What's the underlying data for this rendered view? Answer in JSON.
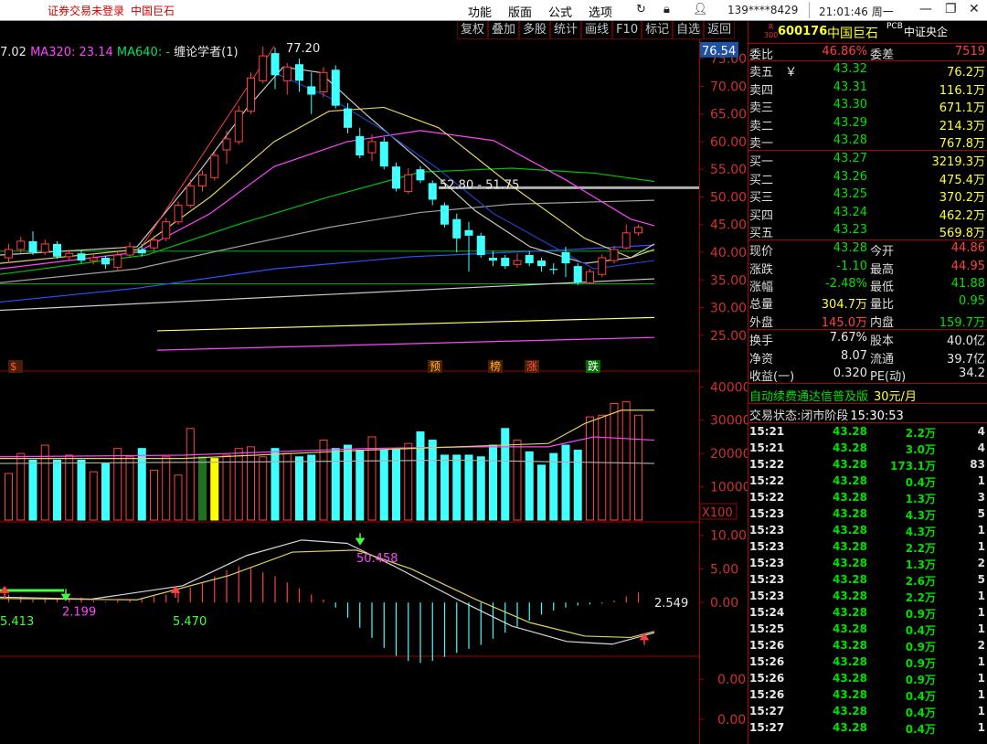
{
  "topbar": {
    "login_status": "证券交易未登录",
    "stock_name": "中国巨石",
    "menus": [
      "功能",
      "版面",
      "公式",
      "选项"
    ],
    "account": "139****8429",
    "clock": "21:01:46 周一"
  },
  "chart_toolbar": [
    "复权",
    "叠加",
    "多股",
    "统计",
    "画线",
    "F10",
    "标记",
    "自选",
    "返回"
  ],
  "legend": {
    "ma_prefix": "7.02",
    "ma320": "MA320: 23.14",
    "ma640": "MA640: -",
    "indicator": "缠论学者(1)"
  },
  "chart_data": [
    {
      "type": "candlestick",
      "price_axis": [
        "75.00",
        "70.00",
        "65.00",
        "60.00",
        "55.00",
        "50.00",
        "45.00",
        "40.00",
        "35.00",
        "30.00",
        "25.00"
      ],
      "ylim": [
        20.5,
        78.5
      ],
      "current_price_tag": "76.54",
      "annotations": {
        "high": "77.20",
        "range": "52.80 - 51.75",
        "markers": [
          "$",
          "预",
          "榜",
          "涨",
          "跌"
        ]
      },
      "candles": [
        {
          "o": 39.0,
          "c": 40.5,
          "h": 41.5,
          "l": 38.0
        },
        {
          "o": 40.5,
          "c": 42.0,
          "h": 42.8,
          "l": 39.8
        },
        {
          "o": 42.0,
          "c": 40.0,
          "h": 43.8,
          "l": 39.5
        },
        {
          "o": 40.0,
          "c": 41.5,
          "h": 42.3,
          "l": 39.5
        },
        {
          "o": 41.5,
          "c": 39.2,
          "h": 42.0,
          "l": 38.8
        },
        {
          "o": 39.2,
          "c": 39.8,
          "h": 40.5,
          "l": 38.5
        },
        {
          "o": 39.8,
          "c": 38.5,
          "h": 40.3,
          "l": 38.0
        },
        {
          "o": 38.5,
          "c": 39.0,
          "h": 39.8,
          "l": 37.8
        },
        {
          "o": 39.0,
          "c": 37.8,
          "h": 39.4,
          "l": 37.0
        },
        {
          "o": 37.3,
          "c": 39.5,
          "h": 40.2,
          "l": 36.8
        },
        {
          "o": 39.5,
          "c": 41.0,
          "h": 41.8,
          "l": 39.0
        },
        {
          "o": 40.5,
          "c": 39.8,
          "h": 41.5,
          "l": 39.2
        },
        {
          "o": 40.8,
          "c": 42.2,
          "h": 43.0,
          "l": 40.2
        },
        {
          "o": 42.5,
          "c": 45.5,
          "h": 46.2,
          "l": 42.0
        },
        {
          "o": 45.5,
          "c": 48.5,
          "h": 49.2,
          "l": 45.0
        },
        {
          "o": 48.5,
          "c": 52.0,
          "h": 53.2,
          "l": 48.0
        },
        {
          "o": 52.0,
          "c": 54.0,
          "h": 54.8,
          "l": 51.0
        },
        {
          "o": 53.5,
          "c": 57.5,
          "h": 58.3,
          "l": 53.0
        },
        {
          "o": 58.5,
          "c": 60.5,
          "h": 62.0,
          "l": 56.0
        },
        {
          "o": 60.0,
          "c": 65.5,
          "h": 66.5,
          "l": 59.5
        },
        {
          "o": 65.5,
          "c": 71.5,
          "h": 72.5,
          "l": 65.0
        },
        {
          "o": 71.0,
          "c": 75.5,
          "h": 77.2,
          "l": 70.5
        },
        {
          "o": 76.0,
          "c": 72.0,
          "h": 77.0,
          "l": 69.5
        },
        {
          "o": 71.0,
          "c": 73.5,
          "h": 74.2,
          "l": 68.5
        },
        {
          "o": 74.0,
          "c": 71.0,
          "h": 75.0,
          "l": 69.0
        },
        {
          "o": 70.0,
          "c": 68.5,
          "h": 72.5,
          "l": 65.0
        },
        {
          "o": 69.0,
          "c": 72.5,
          "h": 73.5,
          "l": 68.0
        },
        {
          "o": 73.0,
          "c": 66.5,
          "h": 73.8,
          "l": 66.0
        },
        {
          "o": 66.0,
          "c": 62.5,
          "h": 67.0,
          "l": 61.5
        },
        {
          "o": 61.0,
          "c": 57.5,
          "h": 62.5,
          "l": 57.0
        },
        {
          "o": 58.0,
          "c": 60.0,
          "h": 61.3,
          "l": 56.5
        },
        {
          "o": 60.0,
          "c": 55.5,
          "h": 60.8,
          "l": 55.0
        },
        {
          "o": 55.5,
          "c": 51.5,
          "h": 56.2,
          "l": 51.0
        },
        {
          "o": 51.0,
          "c": 54.0,
          "h": 55.2,
          "l": 50.5
        },
        {
          "o": 55.0,
          "c": 53.0,
          "h": 55.6,
          "l": 52.5
        },
        {
          "o": 52.5,
          "c": 49.5,
          "h": 53.0,
          "l": 48.5
        },
        {
          "o": 48.5,
          "c": 45.0,
          "h": 49.0,
          "l": 44.5
        },
        {
          "o": 46.0,
          "c": 42.5,
          "h": 47.0,
          "l": 40.0
        },
        {
          "o": 44.0,
          "c": 43.0,
          "h": 45.5,
          "l": 36.5
        },
        {
          "o": 43.0,
          "c": 39.5,
          "h": 43.5,
          "l": 39.0
        },
        {
          "o": 39.0,
          "c": 38.5,
          "h": 40.2,
          "l": 37.5
        },
        {
          "o": 39.0,
          "c": 37.5,
          "h": 39.5,
          "l": 37.0
        },
        {
          "o": 37.8,
          "c": 38.5,
          "h": 39.8,
          "l": 37.2
        },
        {
          "o": 39.5,
          "c": 38.0,
          "h": 40.2,
          "l": 37.5
        },
        {
          "o": 38.5,
          "c": 37.5,
          "h": 39.0,
          "l": 36.5
        },
        {
          "o": 37.0,
          "c": 36.8,
          "h": 38.0,
          "l": 36.0
        },
        {
          "o": 40.0,
          "c": 38.0,
          "h": 41.0,
          "l": 35.5
        },
        {
          "o": 37.5,
          "c": 34.5,
          "h": 38.0,
          "l": 34.0
        },
        {
          "o": 34.5,
          "c": 36.5,
          "h": 37.0,
          "l": 34.2
        },
        {
          "o": 36.0,
          "c": 39.0,
          "h": 39.6,
          "l": 35.5
        },
        {
          "o": 38.5,
          "c": 40.5,
          "h": 41.2,
          "l": 38.0
        },
        {
          "o": 40.8,
          "c": 43.5,
          "h": 45.0,
          "l": 40.5
        },
        {
          "o": 43.5,
          "c": 44.5,
          "h": 45.0,
          "l": 43.0
        }
      ]
    },
    {
      "type": "bar",
      "title": "volume",
      "axis": [
        "40000",
        "30000",
        "20000",
        "10000"
      ],
      "unit": "X100",
      "ylim": [
        0,
        42000
      ],
      "values": [
        14000,
        20000,
        18000,
        22500,
        18000,
        19500,
        18000,
        14500,
        17000,
        21500,
        19000,
        21500,
        15000,
        19000,
        13500,
        27500,
        19000,
        18500,
        19500,
        21500,
        22000,
        19000,
        21500,
        20000,
        19000,
        19500,
        24000,
        21500,
        22500,
        21000,
        25000,
        21000,
        21500,
        23000,
        26500,
        24000,
        19500,
        19500,
        19500,
        19000,
        22500,
        27500,
        24000,
        20500,
        16500,
        20000,
        22500,
        21000,
        31000,
        31500,
        35000,
        35500,
        31500
      ]
    },
    {
      "type": "bar",
      "title": "macd",
      "axis": [
        "10.00",
        "5.00",
        "0.00"
      ],
      "ylim": [
        -8,
        12
      ],
      "labels": [
        "5.413",
        "2.199",
        "5.470",
        "50.458",
        "2.549"
      ],
      "values": [
        0.8,
        0.6,
        0.3,
        0.5,
        0.4,
        0.3,
        0.5,
        0.2,
        0.1,
        0.2,
        0.3,
        0.4,
        0.6,
        0.8,
        1.0,
        1.5,
        2.0,
        2.6,
        3.2,
        3.6,
        3.4,
        3.0,
        2.6,
        2.0,
        1.4,
        0.8,
        0.3,
        -0.5,
        -1.5,
        -2.5,
        -3.5,
        -4.5,
        -5.3,
        -5.8,
        -6.0,
        -5.8,
        -5.4,
        -5.0,
        -4.6,
        -4.2,
        -3.6,
        -3.0,
        -2.4,
        -1.8,
        -1.2,
        -0.8,
        -0.5,
        -0.3,
        -0.2,
        -0.1,
        0.2,
        0.6,
        1.0
      ]
    },
    {
      "type": "bar",
      "title": "empty",
      "axis": [
        "0.00",
        "0.00"
      ]
    }
  ],
  "quote": {
    "code": "600176",
    "name": "中国巨石",
    "badge_r": "R",
    "badge_300": "300",
    "pcb": "PCB",
    "index_tag": "中证央企",
    "weibi_label": "委比",
    "weibi": "46.86%",
    "weicha_label": "委差",
    "weicha": "7519",
    "asks": [
      {
        "label": "卖五",
        "mark": "￥",
        "price": "43.32",
        "vol": "76.2万"
      },
      {
        "label": "卖四",
        "mark": "",
        "price": "43.31",
        "vol": "116.1万"
      },
      {
        "label": "卖三",
        "mark": "",
        "price": "43.30",
        "vol": "671.1万"
      },
      {
        "label": "卖二",
        "mark": "",
        "price": "43.29",
        "vol": "214.3万"
      },
      {
        "label": "卖一",
        "mark": "",
        "price": "43.28",
        "vol": "767.8万"
      }
    ],
    "bids": [
      {
        "label": "买一",
        "price": "43.27",
        "vol": "3219.3万"
      },
      {
        "label": "买二",
        "price": "43.26",
        "vol": "475.4万"
      },
      {
        "label": "买三",
        "price": "43.25",
        "vol": "370.2万"
      },
      {
        "label": "买四",
        "price": "43.24",
        "vol": "462.2万"
      },
      {
        "label": "买五",
        "price": "43.23",
        "vol": "569.8万"
      }
    ],
    "stats": [
      {
        "k1": "现价",
        "v1": "43.28",
        "c1": "g",
        "k2": "今开",
        "v2": "44.86",
        "c2": "r"
      },
      {
        "k1": "涨跌",
        "v1": "-1.10",
        "c1": "g",
        "k2": "最高",
        "v2": "44.95",
        "c2": "r"
      },
      {
        "k1": "涨幅",
        "v1": "-2.48%",
        "c1": "g",
        "k2": "最低",
        "v2": "41.88",
        "c2": "g"
      },
      {
        "k1": "总量",
        "v1": "304.7万",
        "c1": "y",
        "k2": "量比",
        "v2": "0.95",
        "c2": "g"
      },
      {
        "k1": "外盘",
        "v1": "145.0万",
        "c1": "r",
        "k2": "内盘",
        "v2": "159.7万",
        "c2": "g"
      }
    ],
    "fund": [
      {
        "k1": "换手",
        "v1": "7.67%",
        "k2": "股本",
        "v2": "40.0亿"
      },
      {
        "k1": "净资",
        "v1": "8.07",
        "k2": "流通",
        "v2": "39.7亿"
      },
      {
        "k1": "收益(一)",
        "v1": "0.320",
        "k2": "PE(动)",
        "v2": "34.2"
      }
    ],
    "promo_text": "自动续费通达信普及版",
    "promo_price": "30元/月",
    "trade_status_label": "交易状态:闭市阶段",
    "trade_status_time": "15:30:53",
    "ticks": [
      {
        "t": "15:21",
        "p": "43.28",
        "v": "2.2万",
        "n": "4"
      },
      {
        "t": "15:21",
        "p": "43.28",
        "v": "3.0万",
        "n": "4"
      },
      {
        "t": "15:22",
        "p": "43.28",
        "v": "173.1万",
        "n": "83"
      },
      {
        "t": "15:22",
        "p": "43.28",
        "v": "0.4万",
        "n": "1"
      },
      {
        "t": "15:22",
        "p": "43.28",
        "v": "1.3万",
        "n": "3"
      },
      {
        "t": "15:23",
        "p": "43.28",
        "v": "4.3万",
        "n": "5"
      },
      {
        "t": "15:23",
        "p": "43.28",
        "v": "4.3万",
        "n": "1"
      },
      {
        "t": "15:23",
        "p": "43.28",
        "v": "2.2万",
        "n": "1"
      },
      {
        "t": "15:23",
        "p": "43.28",
        "v": "1.3万",
        "n": "2"
      },
      {
        "t": "15:23",
        "p": "43.28",
        "v": "2.6万",
        "n": "5"
      },
      {
        "t": "15:23",
        "p": "43.28",
        "v": "2.2万",
        "n": "1"
      },
      {
        "t": "15:24",
        "p": "43.28",
        "v": "0.9万",
        "n": "1"
      },
      {
        "t": "15:25",
        "p": "43.28",
        "v": "0.4万",
        "n": "1"
      },
      {
        "t": "15:26",
        "p": "43.28",
        "v": "0.9万",
        "n": "2"
      },
      {
        "t": "15:26",
        "p": "43.28",
        "v": "0.9万",
        "n": "1"
      },
      {
        "t": "15:26",
        "p": "43.28",
        "v": "0.9万",
        "n": "1"
      },
      {
        "t": "15:26",
        "p": "43.28",
        "v": "0.4万",
        "n": "1"
      },
      {
        "t": "15:27",
        "p": "43.28",
        "v": "0.4万",
        "n": "1"
      },
      {
        "t": "15:27",
        "p": "43.28",
        "v": "0.4万",
        "n": "1"
      }
    ]
  }
}
